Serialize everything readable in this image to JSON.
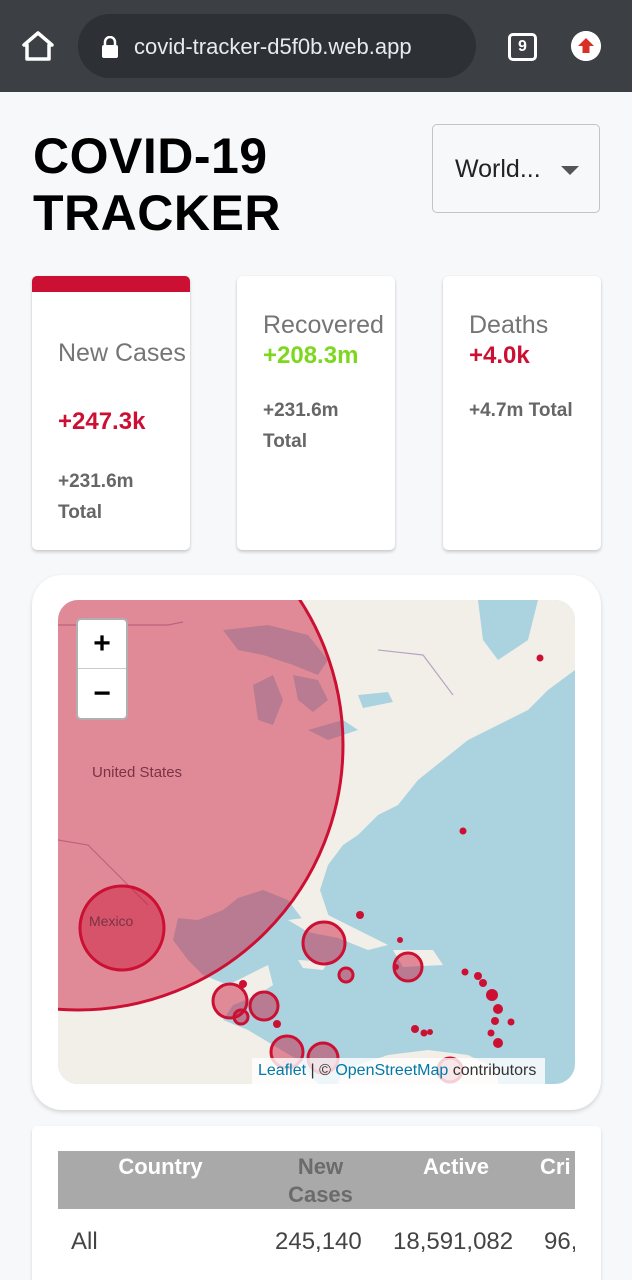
{
  "browser": {
    "url": "covid-tracker-d5f0b.web.app",
    "tab_count": "9"
  },
  "header": {
    "title": "COVID-19 TRACKER",
    "country_select": "World..."
  },
  "stats": [
    {
      "title": "New Cases",
      "delta": "+247.3k",
      "total": "+231.6m Total",
      "delta_color": "#cc1034",
      "active": true
    },
    {
      "title": "Recovered",
      "delta": "+208.3m",
      "total": "+231.6m Total",
      "delta_color": "#7dd71d",
      "active": false
    },
    {
      "title": "Deaths",
      "delta": "+4.0k",
      "total": "+4.7m Total",
      "delta_color": "#cc1034",
      "active": false
    }
  ],
  "map": {
    "label_us": "United States",
    "label_mexico": "Mexico",
    "zoom_in": "+",
    "zoom_out": "−",
    "attribution": {
      "leaflet": "Leaflet",
      "sep": " | © ",
      "osm": "OpenStreetMap",
      "contributors": " contributors"
    },
    "circle_color": "#cc1034"
  },
  "table": {
    "headers": [
      "Country",
      "New Cases",
      "Active",
      "Cri"
    ],
    "rows": [
      {
        "country": "All",
        "new_cases": "245,140",
        "active": "18,591,082",
        "critical": "96,"
      }
    ]
  }
}
